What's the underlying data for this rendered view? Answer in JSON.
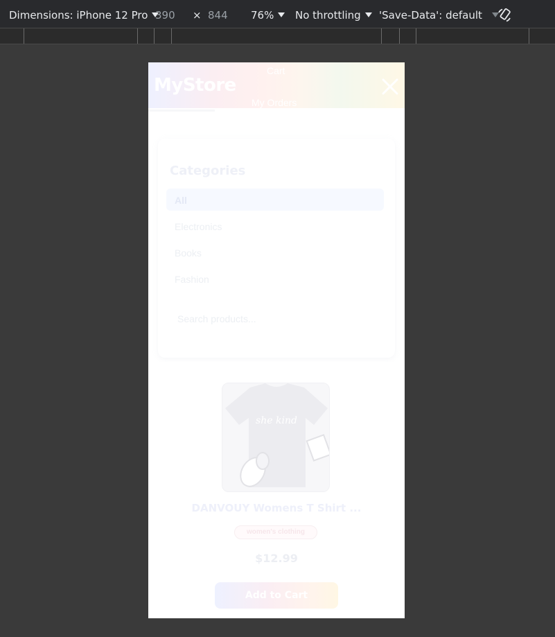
{
  "devtools": {
    "dimensions_label": "Dimensions: iPhone 12 Pro",
    "width": "390",
    "times": "×",
    "height": "844",
    "zoom": "76%",
    "throttling": "No throttling",
    "save_data": "'Save-Data': default",
    "rotate_icon": "rotate-icon"
  },
  "app": {
    "logo": "MyStore",
    "nav": {
      "cart": "Cart",
      "orders": "My Orders"
    },
    "close_icon": "close-icon",
    "categories": {
      "title": "Categories",
      "items": [
        "All",
        "Electronics",
        "Books",
        "Fashion"
      ],
      "active": "All"
    },
    "search": {
      "placeholder": "Search products..."
    },
    "product": {
      "title": "DANVOUY Womens T Shirt ...",
      "category": "women's clothing",
      "price": "$12.99",
      "add_button": "Add to Cart",
      "image_text": "she kind"
    }
  },
  "colors": {
    "devtools_bg": "#292a2d",
    "viewport_bg": "#3a3a3a",
    "device_bg": "#ffffff"
  }
}
